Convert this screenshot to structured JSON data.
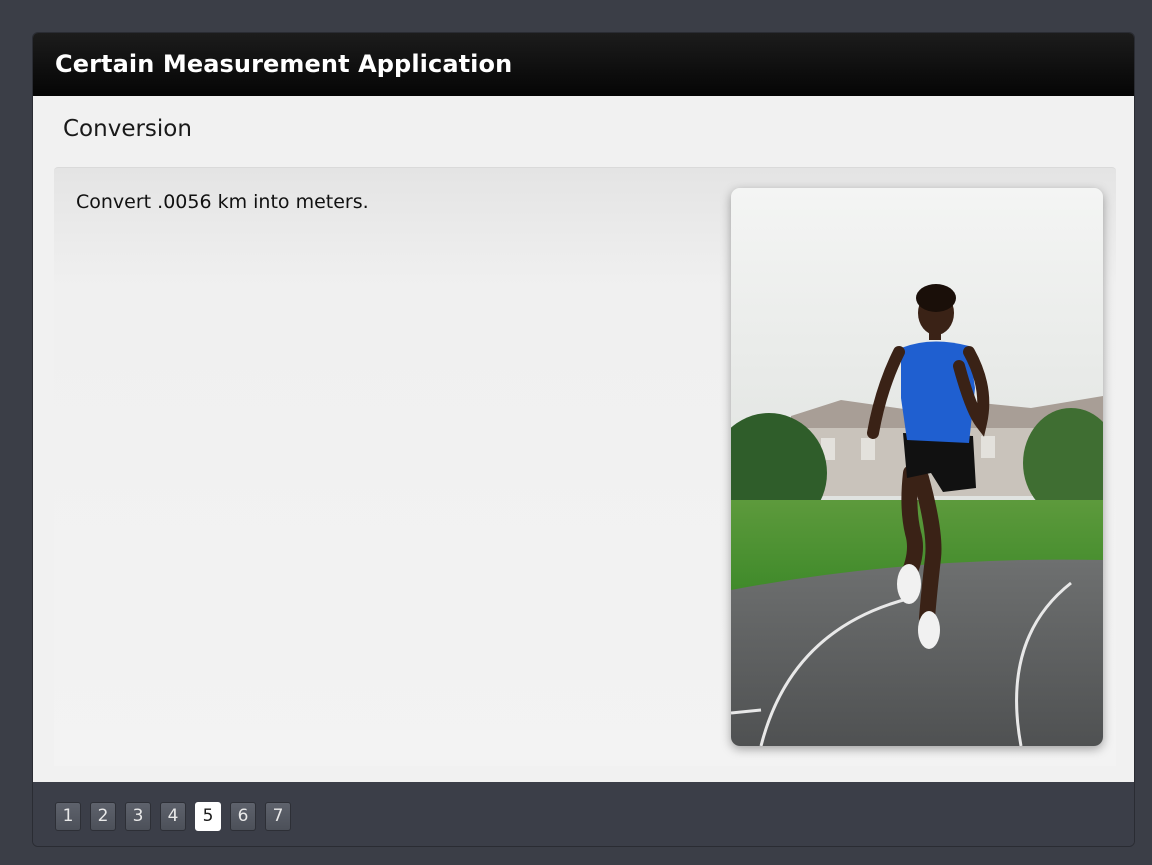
{
  "app": {
    "title": "Certain Measurement Application"
  },
  "section": {
    "title": "Conversion"
  },
  "question": {
    "text": "Convert .0056 km into meters."
  },
  "photo": {
    "description_icon": "photo-sprinter"
  },
  "pagination": {
    "pages": [
      "1",
      "2",
      "3",
      "4",
      "5",
      "6",
      "7"
    ],
    "current": "5"
  },
  "colors": {
    "titlebar": "#000000",
    "frame": "#3b3e47",
    "content": "#f1f1f1",
    "active_page": "#ffffff"
  }
}
